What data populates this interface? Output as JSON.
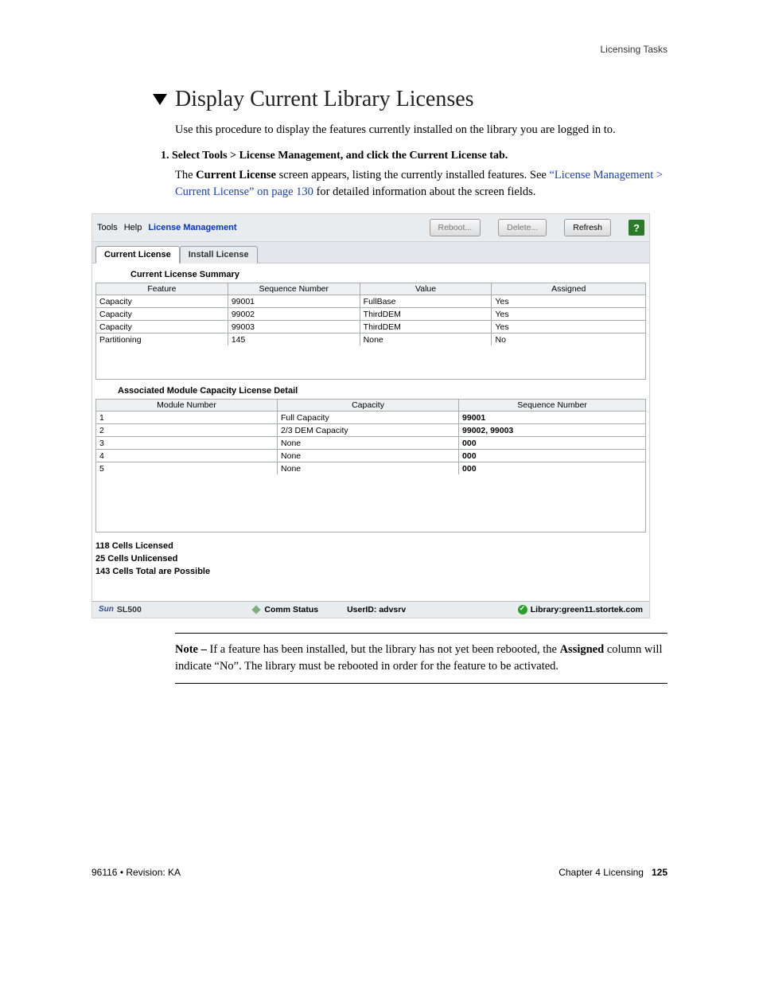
{
  "header": {
    "right": "Licensing Tasks"
  },
  "heading": "Display Current Library Licenses",
  "intro": "Use this procedure to display the features currently installed on the library you are logged in to.",
  "step1_num": "1.",
  "step1_text": "Select Tools > License Management, and click the Current License tab.",
  "step1_body_prefix": "The ",
  "step1_body_bold": "Current License",
  "step1_body_mid": " screen appears, listing the currently installed features. See ",
  "step1_body_link": "“License Management > Current License” on page 130",
  "step1_body_suffix": " for detailed information about the screen fields.",
  "screenshot": {
    "menus": {
      "tools": "Tools",
      "help": "Help",
      "lm": "License Management"
    },
    "buttons": {
      "reboot": "Reboot...",
      "delete": "Delete...",
      "refresh": "Refresh",
      "help": "?"
    },
    "tabs": {
      "current": "Current License",
      "install": "Install License"
    },
    "summary_title": "Current License Summary",
    "summary_headers": [
      "Feature",
      "Sequence Number",
      "Value",
      "Assigned"
    ],
    "summary_rows": [
      [
        "Capacity",
        "99001",
        "FullBase",
        "Yes"
      ],
      [
        "Capacity",
        "99002",
        "ThirdDEM",
        "Yes"
      ],
      [
        "Capacity",
        "99003",
        "ThirdDEM",
        "Yes"
      ],
      [
        "Partitioning",
        "145",
        "None",
        "No"
      ]
    ],
    "detail_title": "Associated Module Capacity License Detail",
    "detail_headers": [
      "Module Number",
      "Capacity",
      "Sequence Number"
    ],
    "detail_rows": [
      [
        "1",
        "Full Capacity",
        "99001"
      ],
      [
        "2",
        "2/3 DEM Capacity",
        "99002, 99003"
      ],
      [
        "3",
        "None",
        "000"
      ],
      [
        "4",
        "None",
        "000"
      ],
      [
        "5",
        "None",
        "000"
      ]
    ],
    "cells": {
      "licensed": "118 Cells Licensed",
      "unlicensed": "25 Cells Unlicensed",
      "total": "143 Cells Total are Possible"
    },
    "status": {
      "sun": "Sun",
      "model": "SL500",
      "comm": "Comm Status",
      "userid": "UserID: advsrv",
      "library": "Library:green11.stortek.com"
    }
  },
  "note": {
    "label": "Note – ",
    "t1": "If a feature has been installed, but the library has not yet been rebooted, the ",
    "bold": "Assigned",
    "t2": " column will indicate “No”. The library must be rebooted in order for the feature to be activated."
  },
  "footer": {
    "left": "96116 • Revision: KA",
    "right_prefix": "Chapter 4 Licensing",
    "right_page": "125"
  }
}
